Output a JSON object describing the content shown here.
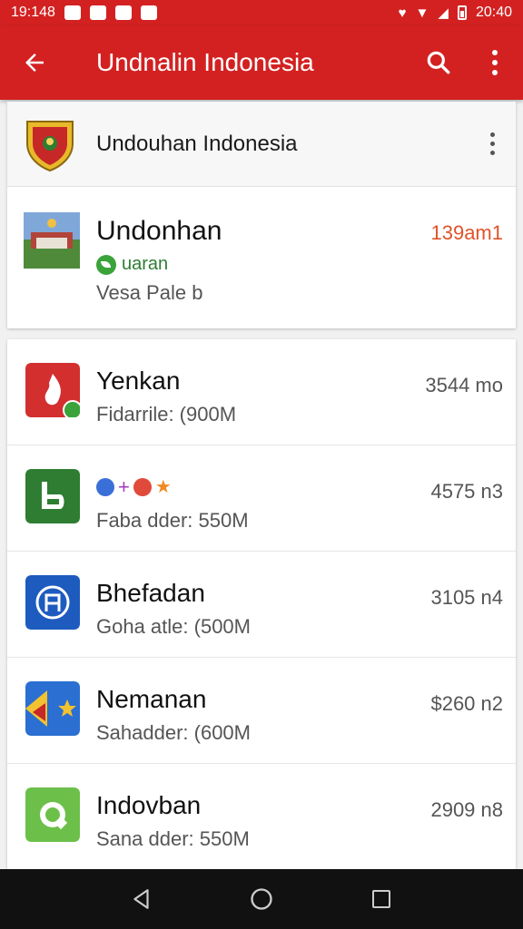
{
  "status_bar": {
    "time_left": "19:148",
    "time_right": "20:40"
  },
  "app_bar": {
    "title": "Undnalin Indonesia",
    "icons": [
      "back-arrow-icon",
      "search-icon",
      "more-vert-icon"
    ]
  },
  "header_card": {
    "title": "Undouhan Indonesia"
  },
  "featured": {
    "name": "Undonhan",
    "tag": "uaran",
    "subtitle": "Vesa Pale b",
    "price": "139am1",
    "price_color": "#e0532a"
  },
  "apps": [
    {
      "name": "Yenkan",
      "subtitle": "Fidarrile: (900M",
      "price": "3544 mo",
      "icon_color": "#d32f2f"
    },
    {
      "name": "",
      "subtitle": "Faba dder: 550M",
      "price": "4575 n3",
      "icon_color": "#2e7d32"
    },
    {
      "name": "Bhefadan",
      "subtitle": "Goha atle: (500M",
      "price": "3105 n4",
      "icon_color": "#1e5bbf"
    },
    {
      "name": "Nemanan",
      "subtitle": "Sahadder: (600M",
      "price": "$260 n2",
      "icon_color": "#2a6fd1"
    },
    {
      "name": "Indovban",
      "subtitle": "Sana dder: 550M",
      "price": "2909 n8",
      "icon_color": "#6cc04a"
    }
  ],
  "colors": {
    "primary": "#d32121",
    "background": "#f1f1f1",
    "nav_bar": "#111111"
  }
}
